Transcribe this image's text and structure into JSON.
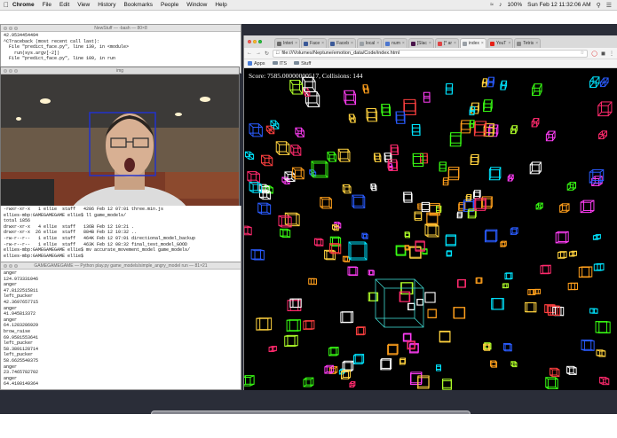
{
  "menubar": {
    "app": "Chrome",
    "items": [
      "File",
      "Edit",
      "View",
      "History",
      "Bookmarks",
      "People",
      "Window",
      "Help"
    ],
    "battery": "100%",
    "clock": "Sun Feb 12  11:32:06 AM"
  },
  "term1": {
    "title": "NewStuff — -bash — 80×8",
    "lines": [
      "42.9534454494",
      "^CTraceback (most recent call last):",
      "  File \"predict_face.py\", line 130, in <module>",
      "    run(sys.argv[-2])",
      "  File \"predict_face.py\", line 109, in run"
    ]
  },
  "imgwin": {
    "title": "img"
  },
  "term2": {
    "lines": [
      "-rwxr-xr-x   1 ellie  staff   4286 Feb 12 07:01 three.min.js",
      "ellies-mbp:GAMEGAMEGAME ellie$ ll game_models/",
      "total 1856",
      "drwxr-xr-x   4 ellie  staff   136B Feb 12 10:21 .",
      "drwxr-xr-x  26 ellie  staff   884B Feb 12 10:32 ..",
      "-rw-r--r--   1 ellie  staff   464K Feb 12 07:01 directional_model_backup",
      "-rw-r--r--   1 ellie  staff   463K Feb 12 08:32 final_test_model_GOOD",
      "ellies-mbp:GAMEGAMEGAME ellie$ mv accurate_movement_model game_models/",
      "ellies-mbp:GAMEGAMEGAME ellie$ "
    ]
  },
  "term3": {
    "title": "GAMEGAMEGAME — Python play.py game_models/simple_angry_model run — 81×21",
    "lines": [
      "anger",
      "124.973331046",
      "anger",
      "47.8122515811",
      "left_pucker",
      "42.3697657715",
      "anger",
      "41.945813372",
      "anger",
      "64.1283286929",
      "brow_raise",
      "69.9581553641",
      "left_pucker",
      "58.3891128714",
      "left_pucker",
      "58.6625540375",
      "anger",
      "23.7465782702",
      "anger",
      "64.4100149364"
    ]
  },
  "chrome": {
    "tabs": [
      {
        "label": "Interi",
        "color": "#6a6a6a"
      },
      {
        "label": "Face",
        "color": "#3b5998"
      },
      {
        "label": "Faceb",
        "color": "#3b5998"
      },
      {
        "label": "local",
        "color": "#9aa0a6"
      },
      {
        "label": "num",
        "color": "#4d77cf"
      },
      {
        "label": "[Slac",
        "color": "#4a154b"
      },
      {
        "label": "[* ar",
        "color": "#d44"
      },
      {
        "label": "index",
        "color": "#9aa0a6"
      },
      {
        "label": "YouT",
        "color": "#e62117"
      },
      {
        "label": "Tetris",
        "color": "#888"
      }
    ],
    "url": "file:///Volumes/Neptune/emotion_data/Code/index.html",
    "bookmarks": [
      {
        "label": "Apps"
      },
      {
        "label": "ITS"
      },
      {
        "label": "Stuff"
      }
    ],
    "score_text": "Score: 7585.00000000517, Collisions: 144"
  },
  "dock": {
    "icons": [
      "finder-icon",
      "preview-icon",
      "terminal-icon",
      "chrome-icon",
      "sublime-icon",
      "activity-monitor-icon",
      "terminal2-icon",
      "script-icon",
      "prefs-icon",
      "document-icon",
      "mail-icon",
      "photos-icon",
      "screenshot-icon",
      "window-icon",
      "trash-icon"
    ],
    "colors": [
      "#4a9ef0",
      "#d9cfbd",
      "#2b2b2b",
      "#f0c040",
      "#f29318",
      "#7ab04a",
      "#333",
      "#9a8a6e",
      "#8a8f96",
      "#eeeeee",
      "#d6e4f2",
      "#cccccc",
      "#e6e6e6",
      "#444",
      "#b8b8b8"
    ]
  }
}
